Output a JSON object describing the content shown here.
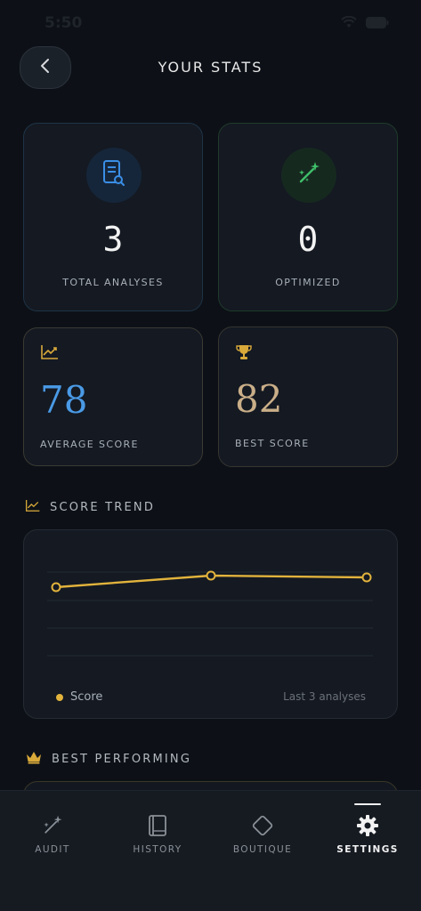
{
  "status_bar": {
    "time": "5:50"
  },
  "header": {
    "title": "YOUR STATS"
  },
  "stats": {
    "total_analyses": {
      "value": "3",
      "label": "TOTAL ANALYSES"
    },
    "optimized": {
      "value": "0",
      "label": "OPTIMIZED"
    },
    "average_score": {
      "value": "78",
      "label": "AVERAGE SCORE"
    },
    "best_score": {
      "value": "82",
      "label": "BEST SCORE"
    }
  },
  "score_trend": {
    "title": "SCORE TREND",
    "legend_label": "Score",
    "range_label": "Last 3 analyses"
  },
  "best_performing": {
    "title": "BEST PERFORMING"
  },
  "tabs": [
    {
      "label": "AUDIT",
      "icon": "magic-wand-icon",
      "active": false
    },
    {
      "label": "HISTORY",
      "icon": "book-icon",
      "active": false
    },
    {
      "label": "BOUTIQUE",
      "icon": "diamond-icon",
      "active": false
    },
    {
      "label": "SETTINGS",
      "icon": "gear-icon",
      "active": true
    }
  ],
  "colors": {
    "background": "#0d1117",
    "card": "#141922",
    "accent_gold": "#e2b33c",
    "accent_blue": "#4a9ae6",
    "accent_green": "#3fbf6a"
  }
}
